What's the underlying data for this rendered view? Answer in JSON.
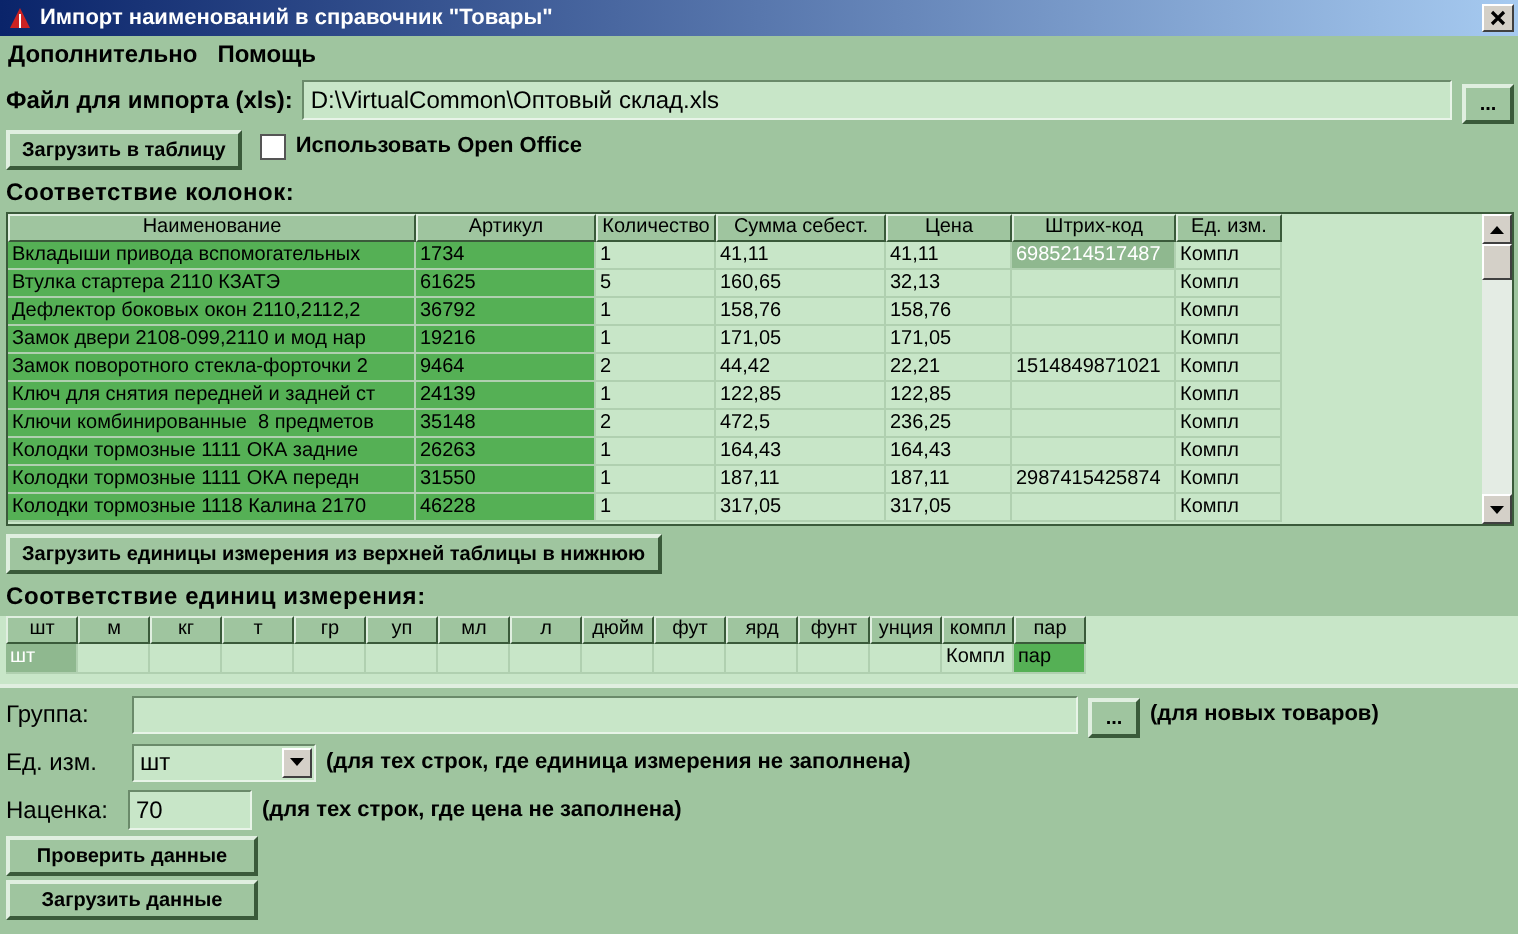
{
  "window": {
    "title": "Импорт наименований в справочник \"Товары\""
  },
  "menu": [
    "Дополнительно",
    "Помощь"
  ],
  "file": {
    "label": "Файл для импорта (xls):",
    "value": "D:\\VirtualCommon\\Оптовый склад.xls",
    "browse": "..."
  },
  "load_button": "Загрузить в таблицу",
  "open_office": {
    "label": "Использовать Open Office",
    "checked": false
  },
  "columns_title": "Соответствие колонок:",
  "table": {
    "columns": [
      {
        "label": "Наименование",
        "highlighted": true
      },
      {
        "label": "Артикул",
        "highlighted": true
      },
      {
        "label": "Количество",
        "highlighted": false
      },
      {
        "label": "Сумма себест.",
        "highlighted": false
      },
      {
        "label": "Цена",
        "highlighted": false
      },
      {
        "label": "Штрих-код",
        "highlighted": false
      },
      {
        "label": "Ед. изм.",
        "highlighted": false
      }
    ],
    "rows": [
      {
        "cells": [
          "Вкладыши привода вспомогательных",
          "1734",
          "1",
          "41,11",
          "41,11",
          "6985214517487",
          "Компл"
        ],
        "barcode_selected": true
      },
      {
        "cells": [
          "Втулка стартера 2110 КЗАТЭ",
          "61625",
          "5",
          "160,65",
          "32,13",
          null,
          "Компл"
        ],
        "barcode_selected": false
      },
      {
        "cells": [
          "Дефлектор боковых окон 2110,2112,2",
          "36792",
          "1",
          "158,76",
          "158,76",
          null,
          "Компл"
        ],
        "barcode_selected": false
      },
      {
        "cells": [
          "Замок двери 2108-099,2110 и мод нар",
          "19216",
          "1",
          "171,05",
          "171,05",
          null,
          "Компл"
        ],
        "barcode_selected": false
      },
      {
        "cells": [
          "Замок поворотного стекла-форточки 2",
          "9464",
          "2",
          "44,42",
          "22,21",
          "1514849871021",
          "Компл"
        ],
        "barcode_selected": false
      },
      {
        "cells": [
          "Ключ для снятия передней и задней ст",
          "24139",
          "1",
          "122,85",
          "122,85",
          null,
          "Компл"
        ],
        "barcode_selected": false
      },
      {
        "cells": [
          "Ключи комбинированные  8 предметов",
          "35148",
          "2",
          "472,5",
          "236,25",
          null,
          "Компл"
        ],
        "barcode_selected": false
      },
      {
        "cells": [
          "Колодки тормозные 1111 ОКА задние",
          "26263",
          "1",
          "164,43",
          "164,43",
          null,
          "Компл"
        ],
        "barcode_selected": false
      },
      {
        "cells": [
          "Колодки тормозные 1111 ОКА передн",
          "31550",
          "1",
          "187,11",
          "187,11",
          "2987415425874",
          "Компл"
        ],
        "barcode_selected": false
      },
      {
        "cells": [
          "Колодки тормозные 1118 Калина 2170",
          "46228",
          "1",
          "317,05",
          "317,05",
          null,
          "Компл"
        ],
        "barcode_selected": false
      }
    ]
  },
  "units_button": "Загрузить единицы измерения из верхней таблицы в нижнюю",
  "units_title": "Соответствие единиц измерения:",
  "units": [
    {
      "label": "шт",
      "value": "шт",
      "selected": true,
      "highlighted": false
    },
    {
      "label": "м",
      "selected": false,
      "highlighted": false
    },
    {
      "label": "кг",
      "selected": false,
      "highlighted": false
    },
    {
      "label": "т",
      "selected": false,
      "highlighted": false
    },
    {
      "label": "гр",
      "selected": false,
      "highlighted": false
    },
    {
      "label": "уп",
      "selected": false,
      "highlighted": false
    },
    {
      "label": "мл",
      "selected": false,
      "highlighted": false
    },
    {
      "label": "л",
      "selected": false,
      "highlighted": false
    },
    {
      "label": "дюйм",
      "selected": false,
      "highlighted": false
    },
    {
      "label": "фут",
      "selected": false,
      "highlighted": false
    },
    {
      "label": "ярд",
      "selected": false,
      "highlighted": false
    },
    {
      "label": "фунт",
      "selected": false,
      "highlighted": false
    },
    {
      "label": "унция",
      "selected": false,
      "highlighted": false
    },
    {
      "label": "компл",
      "value": "Компл",
      "selected": false,
      "highlighted": false
    },
    {
      "label": "пар",
      "value": "пар",
      "selected": false,
      "highlighted": true
    }
  ],
  "group": {
    "label": "Группа:",
    "browse": "...",
    "hint": "(для новых товаров)"
  },
  "unit": {
    "label": "Ед. изм.",
    "value": "шт",
    "hint": "(для тех строк, где единица измерения не заполнена)"
  },
  "markup": {
    "label": "Наценка:",
    "value": "70",
    "hint": "(для тех строк, где цена не заполнена)"
  },
  "buttons": [
    "Проверить данные",
    "Загрузить данные"
  ]
}
